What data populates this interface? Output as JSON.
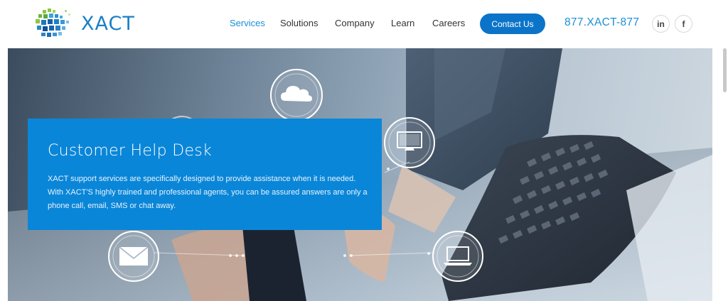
{
  "brand": {
    "name": "XACT",
    "color": "#1b7fc7"
  },
  "nav": {
    "items": [
      {
        "label": "Services",
        "active": true
      },
      {
        "label": "Solutions",
        "active": false
      },
      {
        "label": "Company",
        "active": false
      },
      {
        "label": "Learn",
        "active": false
      },
      {
        "label": "Careers",
        "active": false
      }
    ],
    "contact_label": "Contact Us",
    "phone": "877.XACT-877"
  },
  "social": {
    "linkedin": "in",
    "facebook": "f"
  },
  "hero": {
    "title": "Customer Help Desk",
    "description": "XACT support services are specifically designed to provide assistance when it is needed. With XACT'S highly trained and professional agents, you can be assured answers are only a phone call, email, SMS or chat away.",
    "box_color": "#0a86d8",
    "icons": [
      "cloud-icon",
      "monitor-icon",
      "mail-icon",
      "laptop-icon"
    ]
  }
}
